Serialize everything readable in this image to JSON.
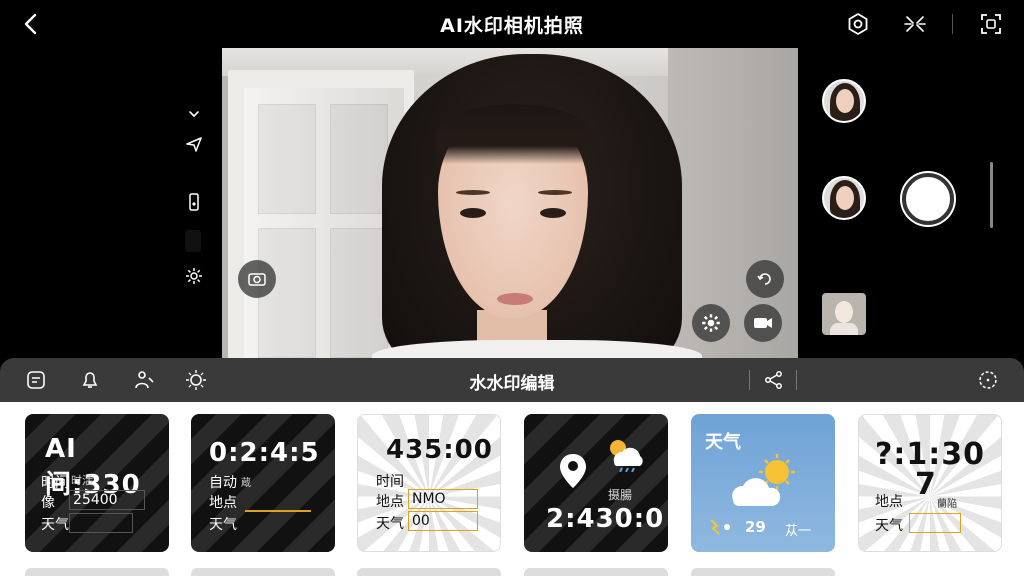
{
  "header": {
    "title": "AI水印相机拍照"
  },
  "editor": {
    "title": "水水印编辑"
  },
  "templates": [
    {
      "time": "AI间:330",
      "line1": "时间",
      "line1_value": "时活",
      "line2": "像",
      "line2_value": "25400",
      "line3": "天气"
    },
    {
      "time": "0:2:4:5",
      "line1": "自动",
      "line1_value": "蔵",
      "line2": "地点",
      "line3": "天气"
    },
    {
      "time": "435:00",
      "line1": "时间",
      "line2": "地点",
      "line2_value": "NMO",
      "line3": "天气",
      "line3_value": "00"
    },
    {
      "time": "2:430:0",
      "label": "摄腸"
    },
    {
      "title": "天气",
      "temp": "29",
      "extra": "苁一"
    },
    {
      "time_a": "?:1:30",
      "time_b": "7",
      "line1": "地点",
      "line1_value": "蘭陥",
      "line2": "天气"
    }
  ]
}
